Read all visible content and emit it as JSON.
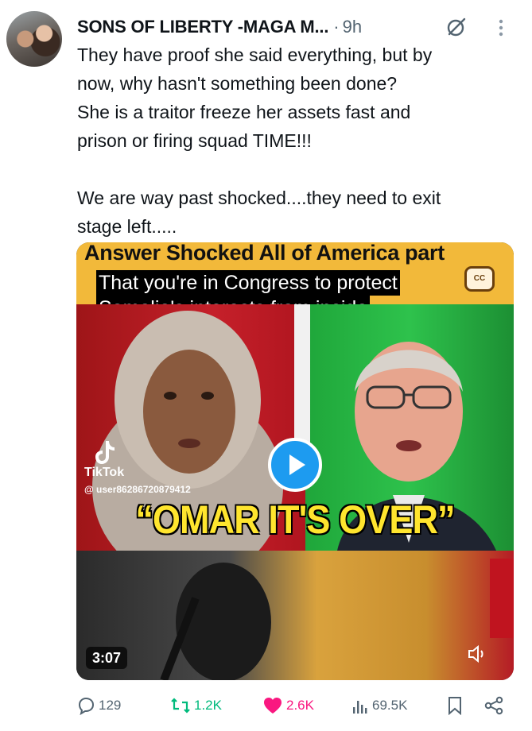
{
  "post": {
    "author": "SONS OF LIBERTY -MAGA M...",
    "separator": "·",
    "time": "9h",
    "body": [
      "They have proof she said everything, but by",
      "now, why hasn't something been done?",
      "She is a traitor freeze  her assets fast and",
      "prison or firing squad TIME!!!",
      "We are way past shocked....they need to exit",
      "stage left....."
    ]
  },
  "media": {
    "banner_title": "Answer Shocked All of America part",
    "caption_lines": [
      "That you're in Congress to protect",
      "Somalia's interests from inside"
    ],
    "cc_label": "CC",
    "headline": "“OMAR IT'S OVER”",
    "tiktok_label": "TikTok",
    "tiktok_user": "@ user86286720879412",
    "duration": "3:07"
  },
  "actions": {
    "replies": "129",
    "reposts": "1.2K",
    "likes": "2.6K",
    "views": "69.5K"
  },
  "colors": {
    "like": "#f91880",
    "repost": "#00ba7c",
    "secondary": "#536471",
    "play": "#1d9bf0",
    "banner": "#f2b93a",
    "headline": "#ffe52e"
  },
  "icons": [
    "grok-icon",
    "more-icon",
    "play-icon",
    "mute-icon",
    "reply-icon",
    "repost-icon",
    "like-icon",
    "views-icon",
    "bookmark-icon",
    "share-icon",
    "tiktok-icon"
  ]
}
